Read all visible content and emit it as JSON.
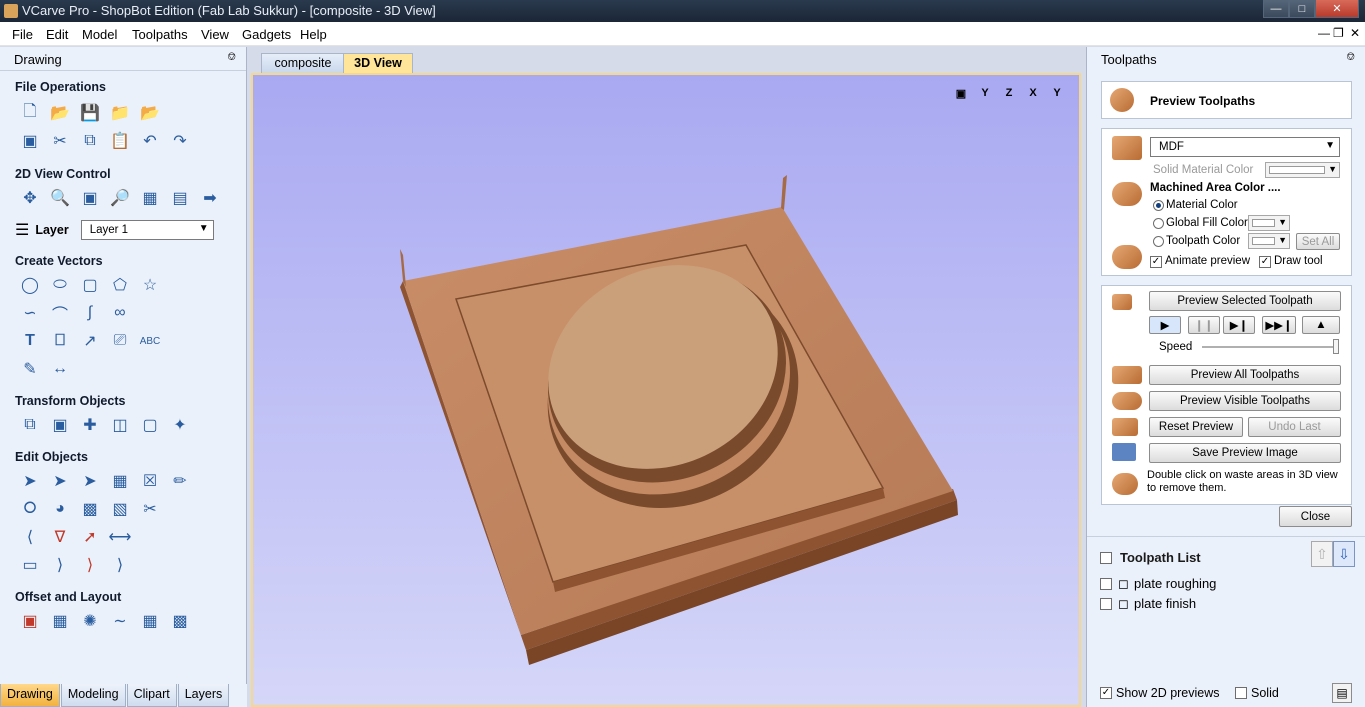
{
  "window": {
    "title": "VCarve Pro - ShopBot Edition (Fab Lab Sukkur) - [composite - 3D View]"
  },
  "menu": [
    "File",
    "Edit",
    "Model",
    "Toolpaths",
    "View",
    "Gadgets",
    "Help"
  ],
  "left_panel": {
    "title": "Drawing",
    "sections": {
      "file_operations": "File Operations",
      "view_control": "2D View Control",
      "create_vectors": "Create Vectors",
      "transform_objects": "Transform Objects",
      "edit_objects": "Edit Objects",
      "offset_layout": "Offset and Layout"
    },
    "layer_label": "Layer",
    "layer_value": "Layer 1",
    "bottom_tabs": [
      "Drawing",
      "Modeling",
      "Clipart",
      "Layers"
    ]
  },
  "doc_tabs": [
    "composite",
    "3D View"
  ],
  "view_icons": [
    "fit",
    "Y",
    "Z",
    "X",
    "Y"
  ],
  "right_panel": {
    "title": "Toolpaths",
    "preview_header": "Preview Toolpaths",
    "material": "MDF",
    "solid_material_color": "Solid Material Color",
    "machined_area_color": "Machined Area Color ....",
    "material_color": "Material Color",
    "global_fill_color": "Global Fill Color",
    "toolpath_color": "Toolpath Color",
    "set_all": "Set All",
    "animate_preview": "Animate preview",
    "draw_tool": "Draw tool",
    "preview_selected": "Preview Selected Toolpath",
    "speed": "Speed",
    "preview_all": "Preview All Toolpaths",
    "preview_visible": "Preview Visible Toolpaths",
    "reset_preview": "Reset Preview",
    "undo_last": "Undo Last",
    "save_preview_image": "Save Preview Image",
    "hint": "Double click on waste areas in 3D view to remove them.",
    "close": "Close",
    "toolpath_list_title": "Toolpath List",
    "toolpaths": [
      "plate roughing",
      "plate finish"
    ],
    "show_2d_previews": "Show 2D previews",
    "solid": "Solid"
  }
}
